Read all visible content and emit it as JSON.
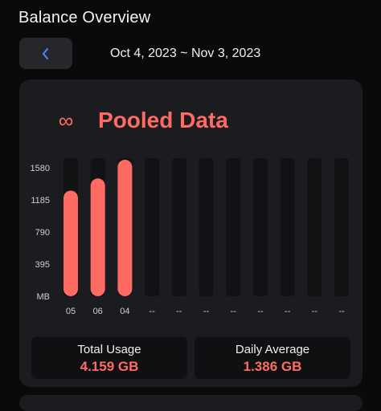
{
  "header": {
    "title": "Balance Overview",
    "back_icon": "chevron-left-icon",
    "date_range": "Oct 4, 2023 ~ Nov 3, 2023"
  },
  "card": {
    "icon_name": "infinity-icon",
    "icon_glyph": "∞",
    "title": "Pooled Data"
  },
  "colors": {
    "accent": "#ff6b63",
    "bar_track": "#111214",
    "back_chevron": "#4a8cff",
    "tick_text": "#cfcfcf"
  },
  "chart_data": {
    "type": "bar",
    "categories": [
      "05",
      "06",
      "04",
      "--",
      "--",
      "--",
      "--",
      "--",
      "--",
      "--",
      "--"
    ],
    "values": [
      1300,
      1450,
      1680,
      null,
      null,
      null,
      null,
      null,
      null,
      null,
      null
    ],
    "y_ticks": [
      "MB",
      "395",
      "790",
      "1185",
      "1580"
    ],
    "y_tick_values": [
      0,
      395,
      790,
      1185,
      1580
    ],
    "ylim": [
      0,
      1700
    ],
    "xlabel": "",
    "ylabel": ""
  },
  "stats": {
    "total_label": "Total Usage",
    "total_value": "4.159 GB",
    "average_label": "Daily Average",
    "average_value": "1.386 GB"
  }
}
